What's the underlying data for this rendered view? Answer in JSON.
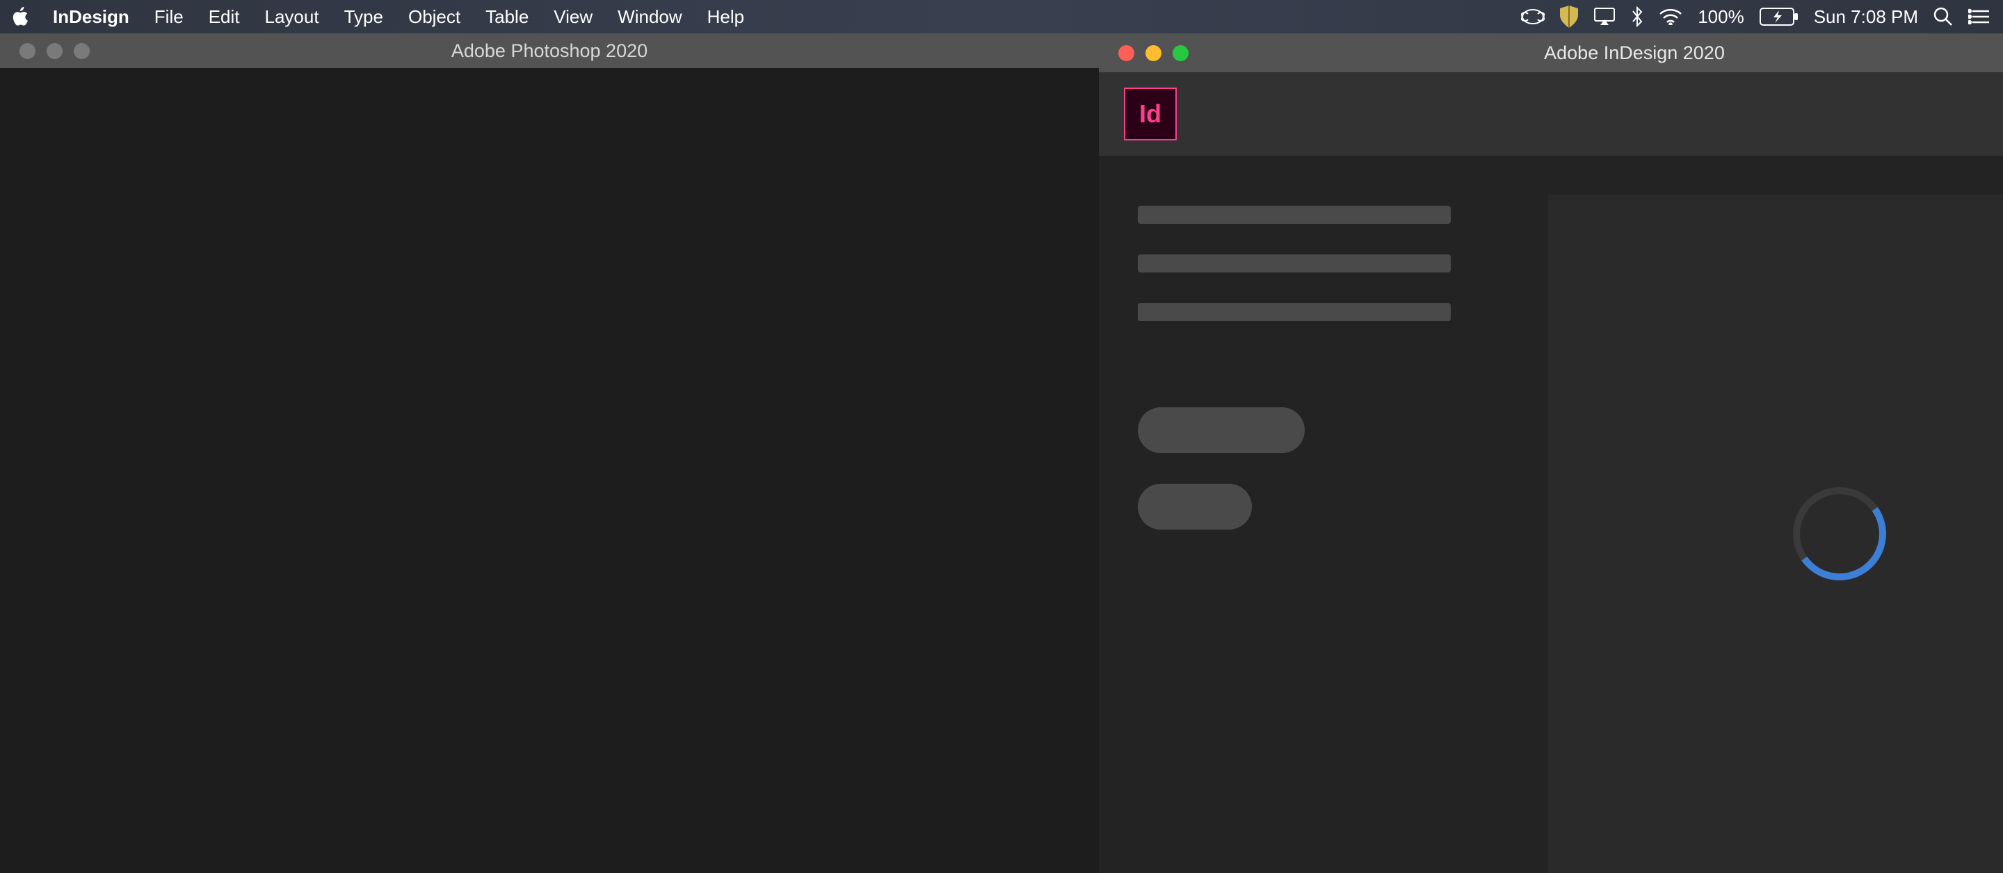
{
  "menubar": {
    "appname": "InDesign",
    "items": [
      "File",
      "Edit",
      "Layout",
      "Type",
      "Object",
      "Table",
      "View",
      "Window",
      "Help"
    ],
    "battery_pct": "100%",
    "clock": "Sun 7:08 PM"
  },
  "photoshop_window": {
    "title": "Adobe Photoshop 2020"
  },
  "indesign_window": {
    "title": "Adobe InDesign 2020",
    "logo_text": "Id"
  }
}
